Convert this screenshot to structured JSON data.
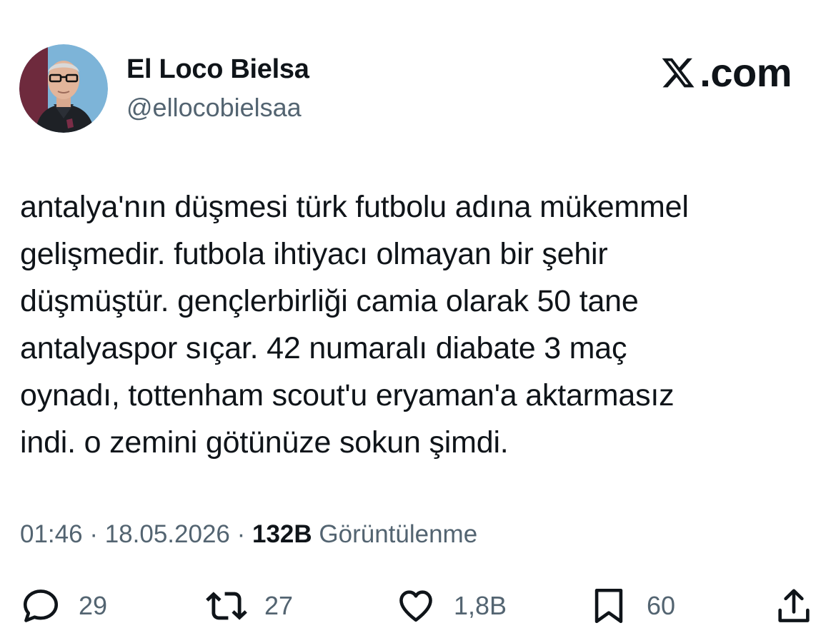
{
  "author": {
    "name": "El Loco Bielsa",
    "handle": "@ellocobielsaa"
  },
  "brand": {
    "label": ".com"
  },
  "tweet": {
    "text": "antalya'nın düşmesi türk futbolu adına mükemmel\ngelişmedir. futbola ihtiyacı olmayan bir şehir\ndüşmüştür. gençlerbirliği camia olarak 50 tane\nantalyaspor sıçar. 42 numaralı diabate 3 maç\noynadı, tottenham scout'u eryaman'a aktarmasız\nindi. o zemini götünüze sokun şimdi."
  },
  "meta": {
    "time": "01:46",
    "separator": " · ",
    "date": "18.05.2026",
    "views_count": "132B",
    "views_label": "Görüntülenme"
  },
  "actions": {
    "replies": "29",
    "reposts": "27",
    "likes": "1,8B",
    "bookmarks": "60"
  },
  "icons": {
    "avatar": "profile-photo",
    "brand": "x-logo-icon",
    "reply": "reply-icon",
    "repost": "repost-icon",
    "like": "heart-icon",
    "bookmark": "bookmark-icon",
    "share": "share-icon"
  },
  "colors": {
    "text": "#0f1419",
    "secondary": "#536471",
    "avatar_bg_left": "#6e2a3d",
    "avatar_bg_right": "#7db4d8"
  }
}
